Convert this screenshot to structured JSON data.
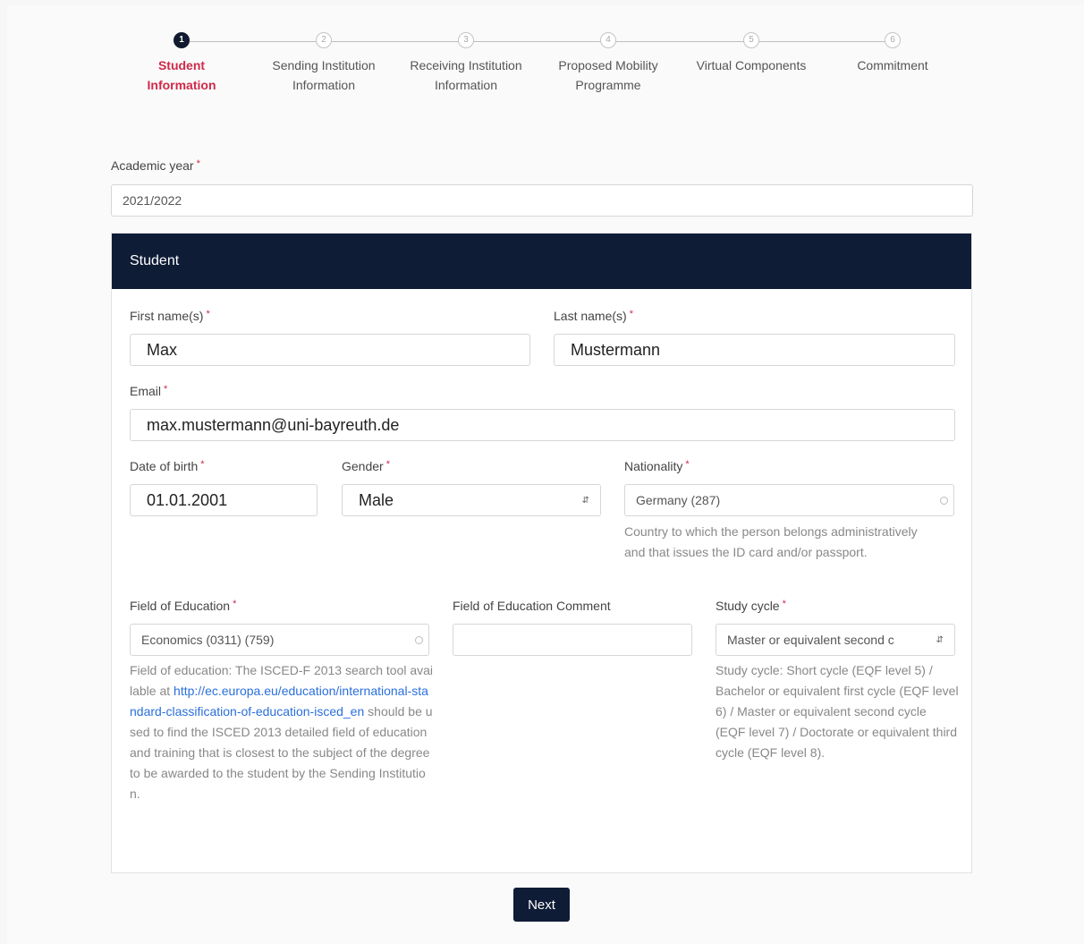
{
  "steps": [
    {
      "number": "1",
      "label_line1": "Student",
      "label_line2": "Information"
    },
    {
      "number": "2",
      "label_line1": "Sending Institution",
      "label_line2": "Information"
    },
    {
      "number": "3",
      "label_line1": "Receiving Institution",
      "label_line2": "Information"
    },
    {
      "number": "4",
      "label_line1": "Proposed Mobility",
      "label_line2": "Programme"
    },
    {
      "number": "5",
      "label_line1": "Virtual Components",
      "label_line2": ""
    },
    {
      "number": "6",
      "label_line1": "Commitment",
      "label_line2": ""
    }
  ],
  "required_marker": "*",
  "academic_year": {
    "label": "Academic year",
    "value": "2021/2022"
  },
  "student": {
    "title": "Student",
    "first_name": {
      "label": "First name(s)",
      "value": "Max"
    },
    "last_name": {
      "label": "Last name(s)",
      "value": "Mustermann"
    },
    "email": {
      "label": "Email",
      "value": "max.mustermann@uni-bayreuth.de"
    },
    "dob": {
      "label": "Date of birth",
      "value": "01.01.2001"
    },
    "gender": {
      "label": "Gender",
      "value": "Male"
    },
    "nationality": {
      "label": "Nationality",
      "value": "Germany (287)",
      "help": "Country to which the person belongs administratively and that issues the ID card and/or passport."
    },
    "field_of_education": {
      "label": "Field of Education",
      "value": "Economics (0311) (759)",
      "help_before": "Field of education: The ISCED-F 2013 search tool available at ",
      "help_link": "http://ec.europa.eu/education/international-standard-classification-of-education-isced_en",
      "help_after": " should be used to find the ISCED 2013 detailed field of education and training that is closest to the subject of the degree to be awarded to the student by the Sending Institution."
    },
    "field_of_education_comment": {
      "label": "Field of Education Comment",
      "value": ""
    },
    "study_cycle": {
      "label": "Study cycle",
      "value": "Master or equivalent second c",
      "help": "Study cycle: Short cycle (EQF level 5) / Bachelor or equivalent first cycle (EQF level 6) / Master or equivalent second cycle (EQF level 7) / Doctorate or equivalent third cycle (EQF level 8)."
    }
  },
  "next_label": "Next"
}
